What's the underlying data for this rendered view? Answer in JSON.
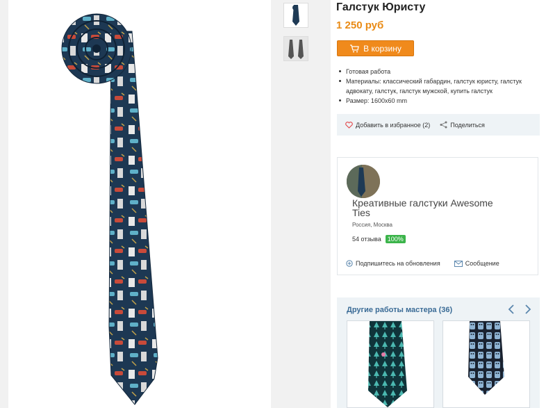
{
  "product": {
    "title": "Галстук Юристу",
    "price": "1 250 руб",
    "cart_label": "В корзину",
    "details": [
      "Готовая работа",
      "Материалы: классический габардин, галстук юристу, галстук адвокату, галстук, галстук мужской, купить галстук",
      "Размер: 1600x60 mm"
    ]
  },
  "actions": {
    "favorite": "Добавить в избранное (2)",
    "share": "Поделиться"
  },
  "seller": {
    "name": "Креативные галстуки Awesome Ties",
    "location": "Россия, Москва",
    "reviews": "54 отзыва",
    "rating": "100%",
    "subscribe": "Подпишитесь на обновления",
    "message": "Сообщение"
  },
  "other_works": {
    "title": "Другие работы мастера (36)"
  },
  "colors": {
    "accent": "#f08a1c",
    "price": "#e98a14",
    "link": "#3a6b96",
    "badge": "#3bb44a",
    "tie": "#1e3a55"
  }
}
